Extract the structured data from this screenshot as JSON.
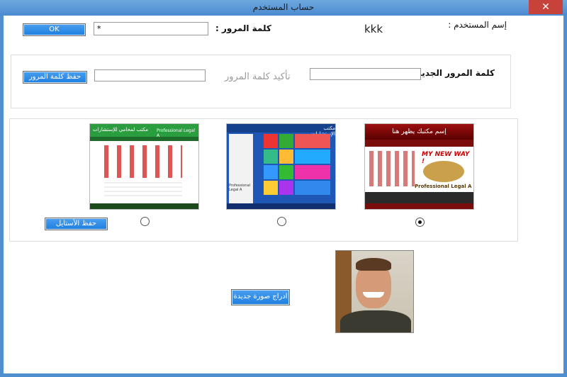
{
  "window": {
    "title": "حساب المستخدم",
    "close": "✕"
  },
  "account": {
    "username_label": "إسم المستخدم :",
    "username_value": "kkk",
    "password_label": "كلمة المرور :",
    "password_value": "*",
    "ok_label": "OK"
  },
  "change_password": {
    "new_password_label": "كلمة المرور الجديدة",
    "confirm_label": "تأكيد كلمة المرور",
    "save_label": "حفظ كلمة المرور"
  },
  "styles": {
    "save_label": "حفظ الأستايل",
    "selected_index": 0,
    "thumbs": [
      {
        "name": "red-theme",
        "banner": "إسم مكتبك يظهر هنا",
        "brand": "MY NEW WAY !",
        "sub": "Professional Legal A"
      },
      {
        "name": "blue-tiles-theme",
        "banner": "مكتب الإستشارات",
        "brand": "Professional Legal A"
      },
      {
        "name": "green-theme",
        "banner": "مكتب لمحامي للإستشارات",
        "brand": "Professional Legal A"
      }
    ]
  },
  "photo": {
    "insert_label": "ادراج صورة جديدة"
  }
}
